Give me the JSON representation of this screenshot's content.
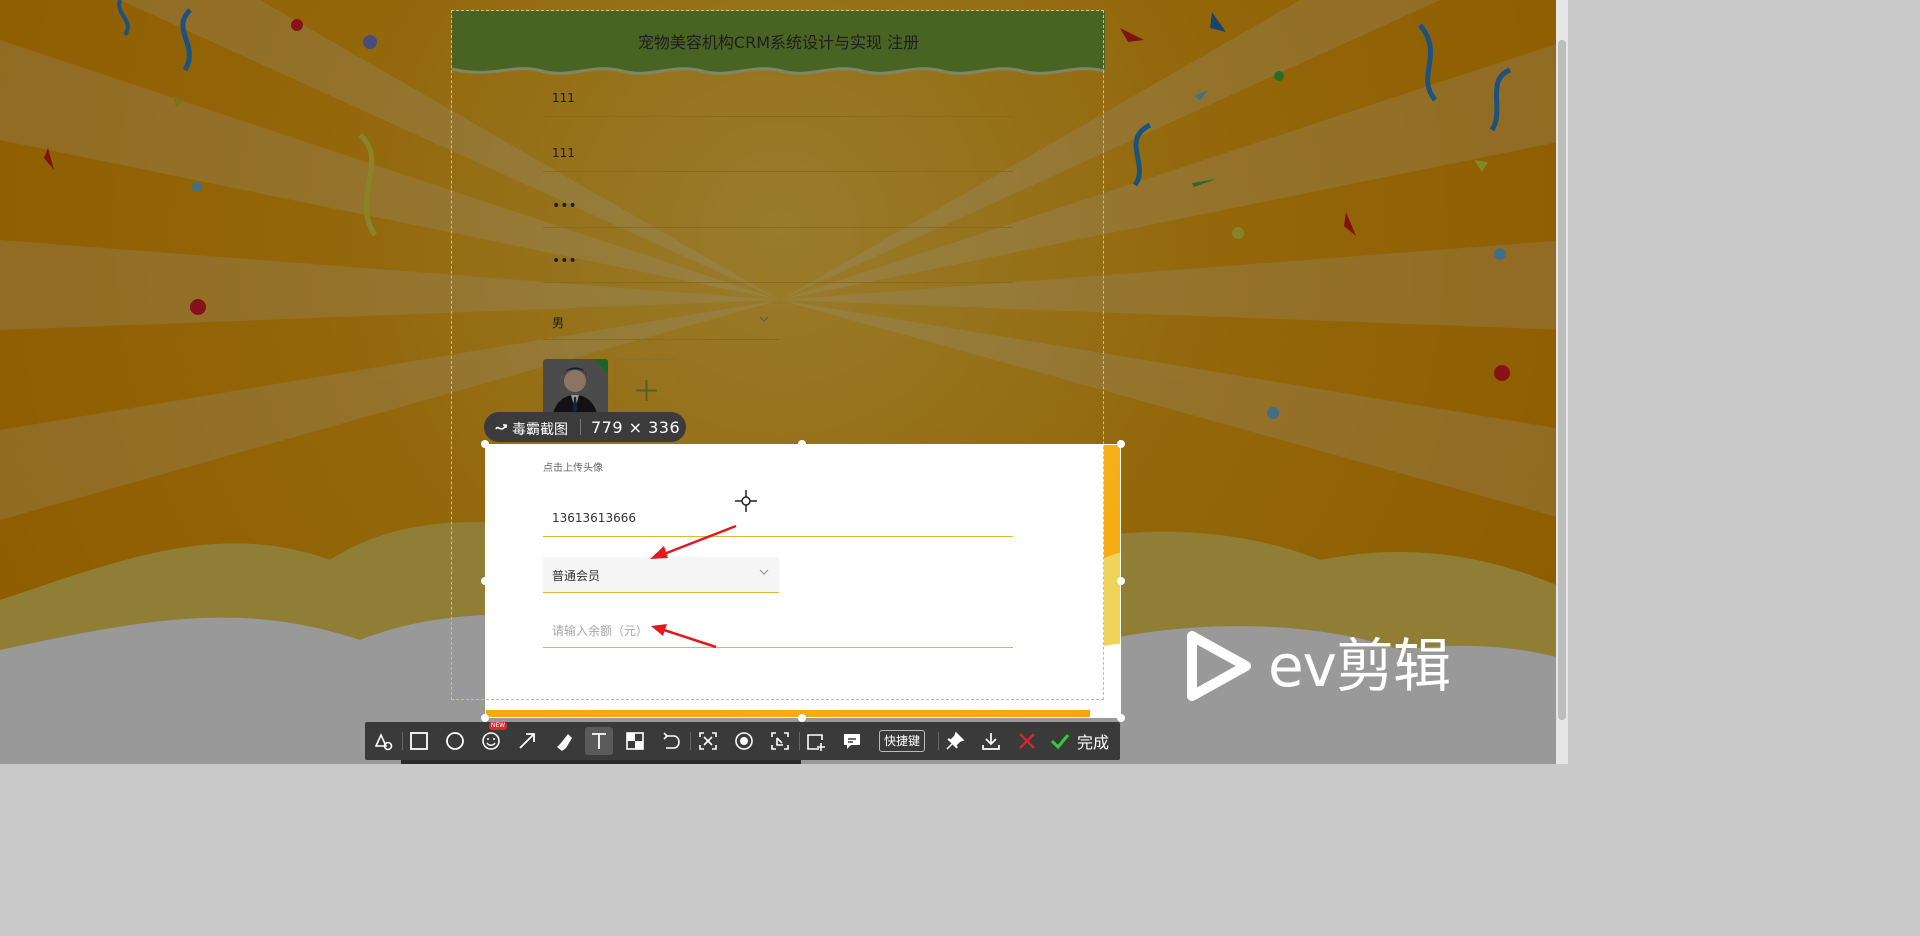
{
  "page": {
    "title": "宠物美容机构CRM系统设计与实现 注册"
  },
  "form": {
    "username_value": "111",
    "name_value": "111",
    "password_value": "•••",
    "confirm_password_value": "•••",
    "gender_selected": "男",
    "avatar_upload_tip": "点击上传头像",
    "phone_value": "13613613666",
    "member_level_selected": "普通会员",
    "balance_placeholder": "请输入余额（元）"
  },
  "capture": {
    "app_name": "毒霸截图",
    "selection_size": "779 × 336"
  },
  "toolbar": {
    "new_badge": "NEW",
    "shortcut_label": "快捷键",
    "finish_label": "完成"
  },
  "watermark": {
    "text": "ev剪辑"
  },
  "colors": {
    "background_orange": "#f2a000",
    "header_green": "#7aa63a",
    "underline_gold": "#e2b536",
    "arrow_red": "#e0191f",
    "finish_green": "#2ecc40"
  }
}
